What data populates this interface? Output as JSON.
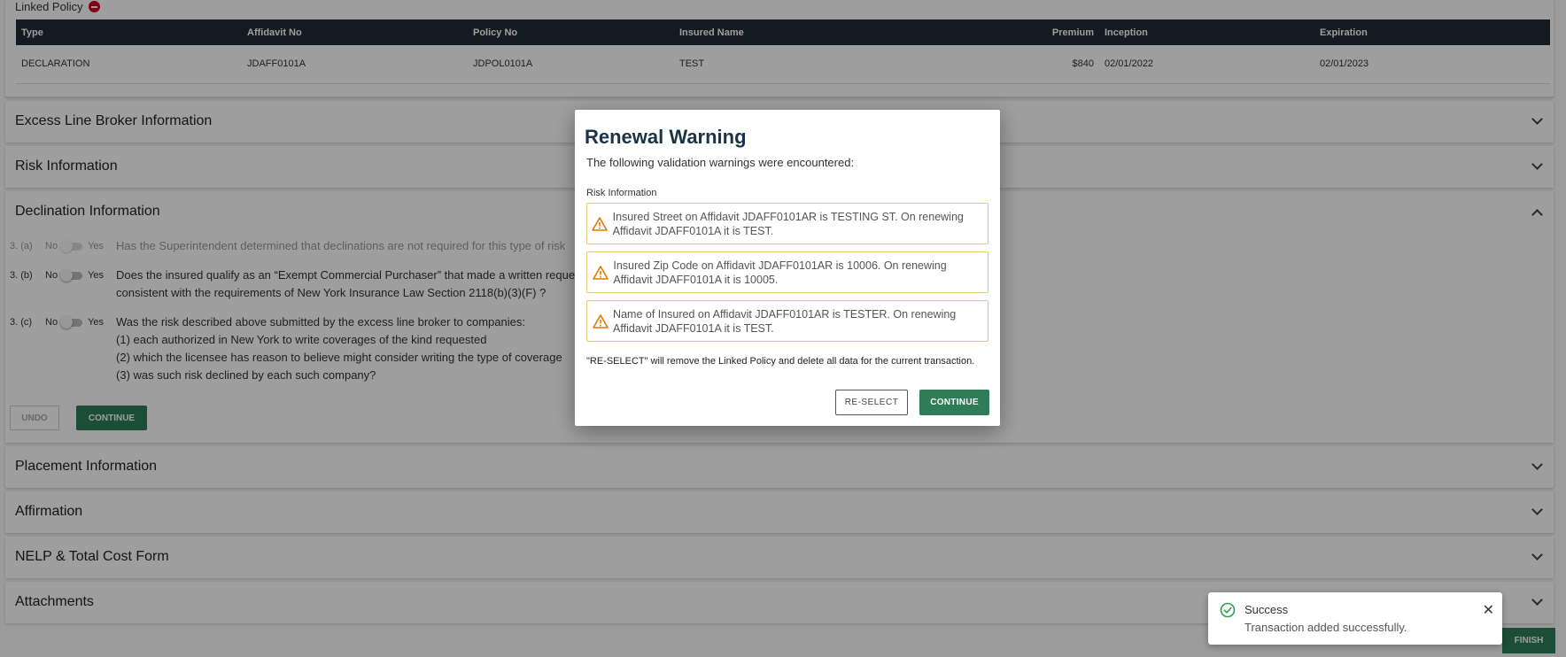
{
  "linked_policy": {
    "title": "Linked Policy",
    "columns": [
      "Type",
      "Affidavit No",
      "Policy No",
      "Insured Name",
      "Premium",
      "Inception",
      "Expiration"
    ],
    "row": {
      "type": "DECLARATION",
      "affidavit_no": "JDAFF0101A",
      "policy_no": "JDPOL0101A",
      "insured_name": "TEST",
      "premium": "$840",
      "inception": "02/01/2022",
      "expiration": "02/01/2023"
    }
  },
  "sections": {
    "excess": "Excess Line Broker Information",
    "risk": "Risk Information",
    "declination": "Declination Information",
    "placement": "Placement Information",
    "affirmation": "Affirmation",
    "nelp": "NELP & Total Cost Form",
    "attachments": "Attachments"
  },
  "declination": {
    "no_label": "No",
    "yes_label": "Yes",
    "q3a": {
      "num": "3. (a)",
      "text": "Has the Superintendent determined that declinations are not required for this type of risk"
    },
    "q3b": {
      "num": "3. (b)",
      "line1": "Does the insured qualify as an “Exempt Commercial Purchaser” that made a written request",
      "line2": "consistent with the requirements of New York Insurance Law Section 2118(b)(3)(F) ?"
    },
    "q3c": {
      "num": "3. (c)",
      "line1": "Was the risk described above submitted by the excess line broker to companies:",
      "line2": "(1) each authorized in New York to write coverages of the kind requested",
      "line3": "(2) which the licensee has reason to believe might consider writing the type of coverage",
      "line4": "(3) was such risk declined by each such company?"
    },
    "undo_label": "UNDO",
    "continue_label": "CONTINUE"
  },
  "modal": {
    "title": "Renewal Warning",
    "subtitle": "The following validation warnings were encountered:",
    "section_label": "Risk Information",
    "warnings": [
      {
        "text": "Insured Street on Affidavit JDAFF0101AR is TESTING ST. On renewing Affidavit JDAFF0101A it is TEST."
      },
      {
        "text": "Insured Zip Code on Affidavit JDAFF0101AR is 10006. On renewing Affidavit JDAFF0101A it is 10005."
      },
      {
        "text": "Name of Insured on Affidavit JDAFF0101AR is TESTER. On renewing Affidavit JDAFF0101A it is TEST."
      }
    ],
    "note": "\"RE-SELECT\" will remove the Linked Policy and delete all data for the current transaction.",
    "reselect_label": "RE-SELECT",
    "continue_label": "CONTINUE"
  },
  "toast": {
    "title": "Success",
    "message": "Transaction added successfully.",
    "close_label": "✕"
  },
  "finish_label": "FINISH",
  "colors": {
    "accent": "#2e7d57",
    "header": "#1f2a36",
    "warning": "#e07b00"
  }
}
